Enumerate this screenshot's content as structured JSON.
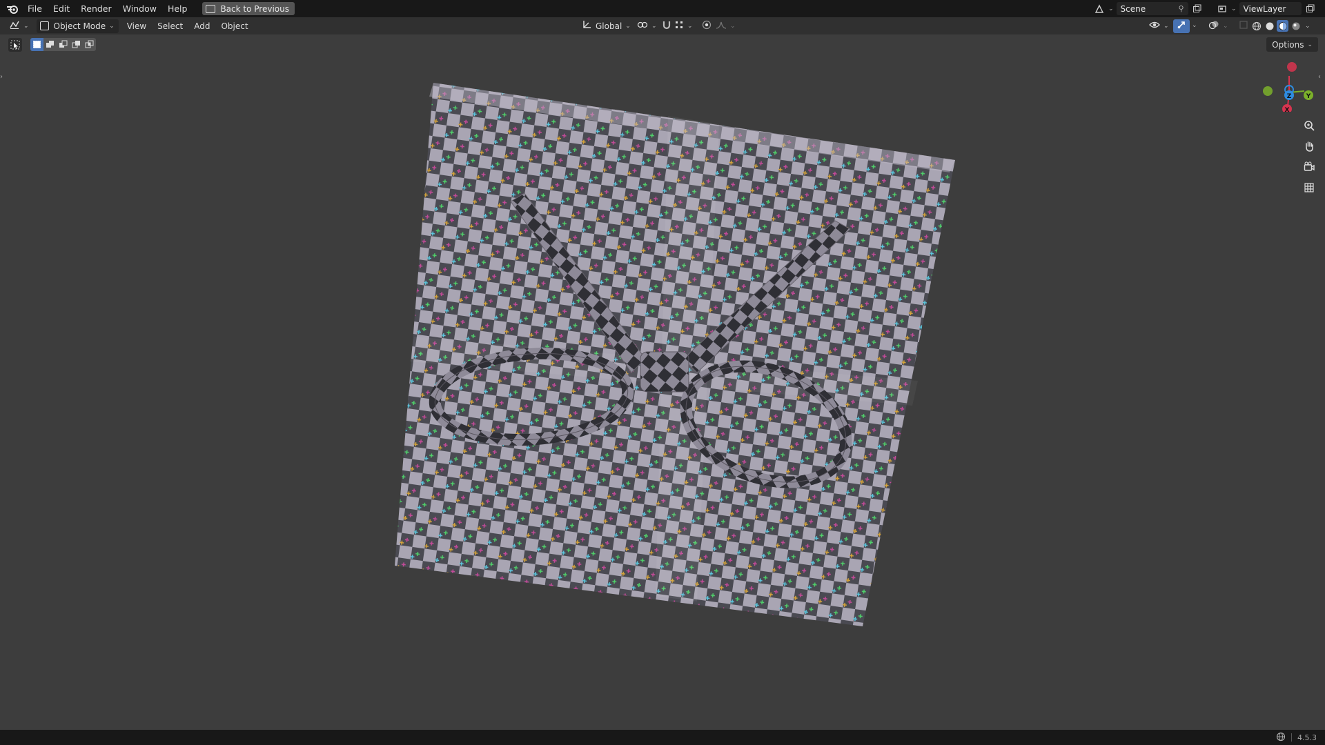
{
  "topbar": {
    "menus": [
      "File",
      "Edit",
      "Render",
      "Window",
      "Help"
    ],
    "back_label": "Back to Previous",
    "scene_label": "Scene",
    "viewlayer_label": "ViewLayer"
  },
  "header": {
    "mode_label": "Object Mode",
    "menus": [
      "View",
      "Select",
      "Add",
      "Object"
    ],
    "transform_orientation": "Global",
    "options_label": "Options"
  },
  "gizmo": {
    "axes": {
      "x": "X",
      "y": "Y",
      "z": "Z"
    },
    "colors": {
      "x": "#d7344f",
      "y": "#7bb02a",
      "z": "#2e8ce0"
    }
  },
  "statusbar": {
    "version": "4.5.3"
  },
  "colors": {
    "accent": "#4772b3",
    "background": "#3d3d3d",
    "topbar": "#181818",
    "header": "#303030"
  },
  "icons": [
    "blender-logo-icon",
    "back-icon",
    "scene-icon",
    "pin-icon",
    "new-scene-icon",
    "viewlayer-icon",
    "editor-type-icon",
    "object-mode-icon",
    "orientation-icon",
    "pivot-icon",
    "snap-icon",
    "proportional-icon",
    "visibility-icon",
    "gizmo-icon",
    "overlay-icon",
    "xray-icon",
    "wireframe-shading-icon",
    "solid-shading-icon",
    "material-shading-icon",
    "rendered-shading-icon",
    "zoom-icon",
    "pan-hand-icon",
    "camera-icon",
    "grid-icon",
    "globe-icon"
  ]
}
